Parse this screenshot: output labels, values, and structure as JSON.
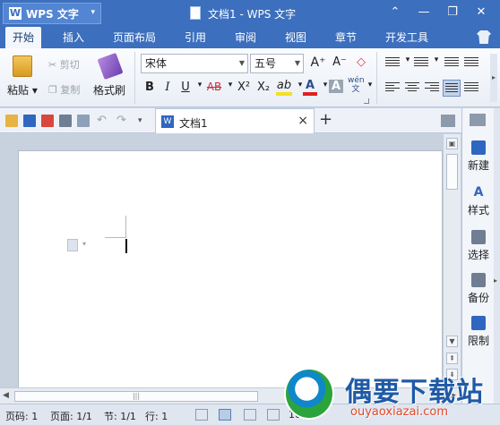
{
  "titlebar": {
    "app_name": "WPS 文字",
    "doc_title": "文档1 - WPS 文字",
    "minimize": "⌃",
    "min2": "—",
    "restore": "❐",
    "close": "✕"
  },
  "menu": {
    "items": [
      "开始",
      "插入",
      "页面布局",
      "引用",
      "审阅",
      "视图",
      "章节",
      "开发工具"
    ],
    "active": "开始"
  },
  "ribbon": {
    "paste": "粘贴",
    "cut": "剪切",
    "copy": "复制",
    "format_painter": "格式刷",
    "font_name": "宋体",
    "font_size": "五号",
    "grow_font": "A⁺",
    "shrink_font": "A⁻",
    "clear_format": "◇",
    "bold": "B",
    "italic": "I",
    "underline": "U",
    "strike": "AB",
    "superscript": "X²",
    "subscript": "X₂",
    "highlight": "ab",
    "font_color": "A",
    "char_shading": "A",
    "phonetic": "wén\n文"
  },
  "tabs": {
    "doc_tab_label": "文档1",
    "close": "×",
    "new": "+"
  },
  "right_panel": {
    "items": [
      "新建",
      "样式",
      "选择",
      "备份",
      "限制"
    ]
  },
  "statusbar": {
    "page_no": "页码: 1",
    "pages": "页面: 1/1",
    "section": "节: 1/1",
    "row": "行: 1",
    "zoom": "100%"
  },
  "watermark": {
    "site_cn": "偶要下载站",
    "site_url": "ouyaoxiazai.com"
  },
  "colors": {
    "title_blue": "#3c6fbd",
    "font_color_red": "#e02020",
    "highlight_yellow": "#f5e020"
  }
}
